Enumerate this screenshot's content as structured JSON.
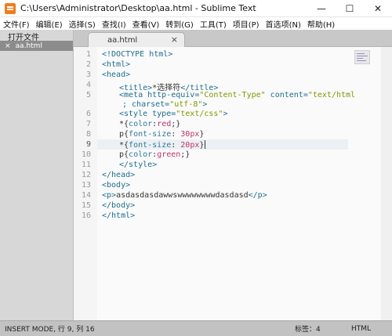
{
  "window": {
    "title": "C:\\Users\\Administrator\\Desktop\\aa.html - Sublime Text",
    "controls": [
      "—",
      "☐",
      "✕"
    ]
  },
  "menu": [
    "文件(F)",
    "编辑(E)",
    "选择(S)",
    "查找(I)",
    "查看(V)",
    "转到(G)",
    "工具(T)",
    "项目(P)",
    "首选项(N)",
    "帮助(H)"
  ],
  "sidebar": {
    "header": "打开文件",
    "files": [
      {
        "close": "×",
        "name": "aa.html"
      }
    ]
  },
  "tab": {
    "label": "aa.html",
    "close": "×"
  },
  "editor": {
    "line_numbers": [
      "1",
      "2",
      "3",
      "4",
      "5",
      "",
      "6",
      "7",
      "8",
      "9",
      "10",
      "11",
      "12",
      "13",
      "14",
      "15",
      "16"
    ],
    "current_line": "9"
  },
  "code": {
    "l1": "<!DOCTYPE html>",
    "l2_open": "<html>",
    "l3_open": "<head>",
    "l4a": "<title>",
    "l4b": "*选择符",
    "l4c": "</title>",
    "l5a": "<meta http-equiv=",
    "l5b": "\"Content-Type\"",
    "l5c": " content=",
    "l5d": "\"text/html",
    "l5e": "; charset=",
    "l5f": "\"utf-8\"",
    "l5g": ">",
    "l6a": "<style type=",
    "l6b": "\"text/css\"",
    "l6c": ">",
    "l7a": "*{",
    "l7b": "color",
    "l7c": ":",
    "l7d": "red",
    "l7e": ";}",
    "l8a": "p{",
    "l8b": "font-size",
    "l8c": ": ",
    "l8d": "30px",
    "l8e": "}",
    "l9a": "*{",
    "l9b": "font-size",
    "l9c": ": ",
    "l9d": "20px",
    "l9e": "}",
    "l10a": "p{",
    "l10b": "color",
    "l10c": ":",
    "l10d": "green",
    "l10e": ";}",
    "l11": "</style>",
    "l12": "</head>",
    "l13": "<body>",
    "l14a": "<p>",
    "l14b": "asdasdasdawwswwwwwwwwdasdasd",
    "l14c": "</p>",
    "l15": "</body>",
    "l16": "</html>"
  },
  "status": {
    "mode": "INSERT MODE, 行 9, 列 16",
    "tab_size": "标签：4",
    "syntax": "HTML"
  },
  "colors": {
    "tag": "#1e6e8f",
    "string": "#7e9a00",
    "value": "#c03366",
    "sidebar_bg": "#d7d7d7",
    "statusbar_bg": "#c2c2c2"
  }
}
